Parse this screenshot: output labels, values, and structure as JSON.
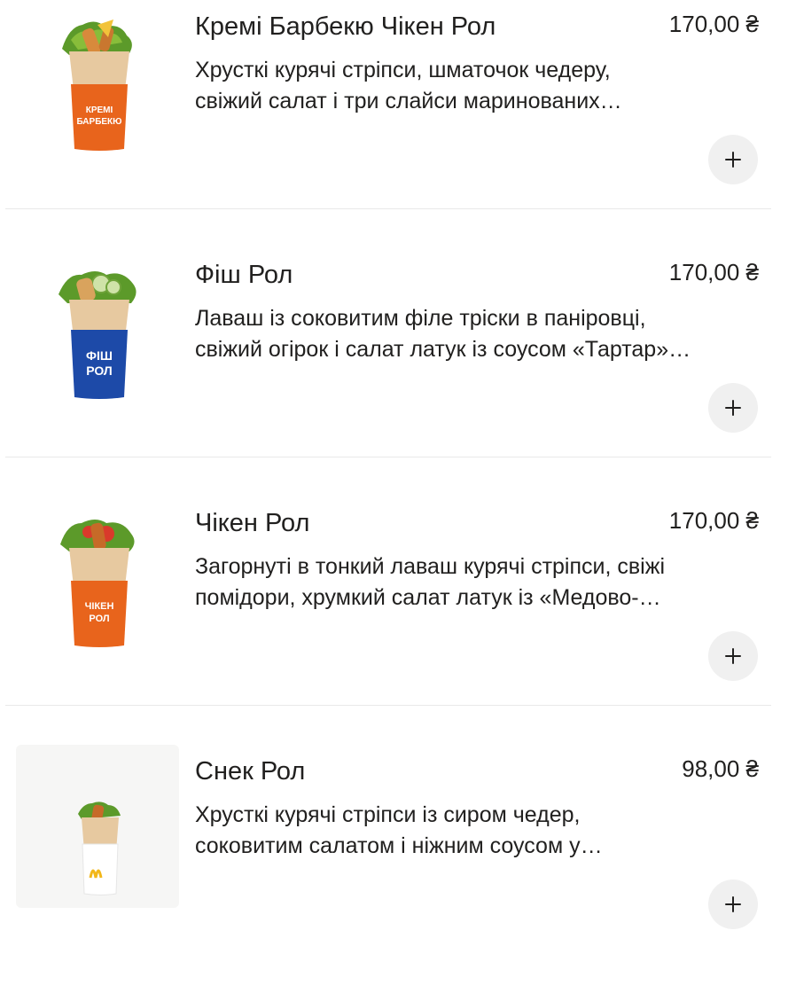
{
  "currency_symbol": "₴",
  "items": [
    {
      "title": "Кремі Барбекю Чікен Рол",
      "price": "170,00 ₴",
      "desc_line1": "Хрусткі курячі стріпси, шматочок чедеру,",
      "desc_line2": "свіжий салат і три слайси маринованих…",
      "wrap_label_line1": "КРЕМІ",
      "wrap_label_line2": "БАРБЕКЮ",
      "wrap_color": "#e8641c"
    },
    {
      "title": "Фіш Рол",
      "price": "170,00 ₴",
      "desc_line1": "Лаваш із соковитим філе тріски в паніровці,",
      "desc_line2": "свіжий огірок і салат латук із соусом «Тартар»…",
      "wrap_label_line1": "ФІШ",
      "wrap_label_line2": "РОЛ",
      "wrap_color": "#1d4aa8"
    },
    {
      "title": "Чікен Рол",
      "price": "170,00 ₴",
      "desc_line1": "Загорнуті в тонкий лаваш курячі стріпси, свіжі",
      "desc_line2": "помідори, хрумкий салат латук із «Медово-…",
      "wrap_label_line1": "ЧІКЕН",
      "wrap_label_line2": "РОЛ",
      "wrap_color": "#e8641c"
    },
    {
      "title": "Снек Рол",
      "price": "98,00 ₴",
      "desc_line1": "Хрусткі курячі стріпси із сиром чедер,",
      "desc_line2": "соковитим салатом і ніжним соусом у…",
      "wrap_label_line1": "",
      "wrap_label_line2": "",
      "wrap_color": "#ffffff"
    }
  ]
}
